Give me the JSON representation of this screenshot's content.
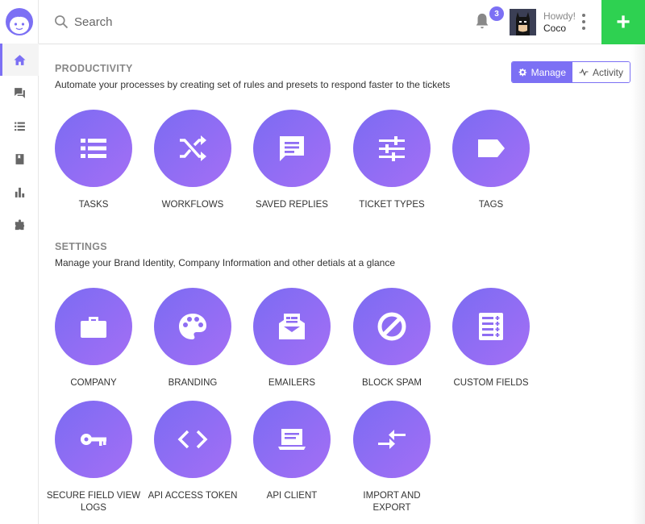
{
  "header": {
    "search_placeholder": "Search",
    "notification_count": "3",
    "greeting": "Howdy!",
    "username": "Coco",
    "add_label": "+"
  },
  "sidebar": {
    "items": [
      {
        "icon": "home-icon",
        "active": true
      },
      {
        "icon": "chat-icon",
        "active": false
      },
      {
        "icon": "list-icon",
        "active": false
      },
      {
        "icon": "book-icon",
        "active": false
      },
      {
        "icon": "bar-chart-icon",
        "active": false
      },
      {
        "icon": "puzzle-icon",
        "active": false
      }
    ]
  },
  "productivity": {
    "title": "PRODUCTIVITY",
    "description": "Automate your processes by creating set of rules and presets to respond faster to the tickets",
    "toggle": {
      "manage": "Manage",
      "activity": "Activity"
    },
    "tiles": [
      {
        "label": "TASKS",
        "icon": "list-icon"
      },
      {
        "label": "WORKFLOWS",
        "icon": "shuffle-icon"
      },
      {
        "label": "SAVED REPLIES",
        "icon": "message-icon"
      },
      {
        "label": "TICKET TYPES",
        "icon": "sliders-icon"
      },
      {
        "label": "TAGS",
        "icon": "tag-icon"
      }
    ]
  },
  "settings": {
    "title": "SETTINGS",
    "description": "Manage your Brand Identity, Company Information and other detials at a glance",
    "tiles": [
      {
        "label": "COMPANY",
        "icon": "briefcase-icon"
      },
      {
        "label": "BRANDING",
        "icon": "palette-icon"
      },
      {
        "label": "EMAILERS",
        "icon": "envelope-icon"
      },
      {
        "label": "BLOCK SPAM",
        "icon": "block-icon"
      },
      {
        "label": "CUSTOM FIELDS",
        "icon": "form-icon"
      },
      {
        "label": "SECURE FIELD VIEW LOGS",
        "icon": "key-icon"
      },
      {
        "label": "API ACCESS TOKEN",
        "icon": "code-icon"
      },
      {
        "label": "API CLIENT",
        "icon": "laptop-icon"
      },
      {
        "label": "IMPORT AND EXPORT",
        "icon": "transfer-icon"
      }
    ]
  },
  "colors": {
    "accent": "#7c70f4",
    "add_button": "#2ed151",
    "gradient_start": "#7b6cf2",
    "gradient_end": "#a46ef5"
  }
}
